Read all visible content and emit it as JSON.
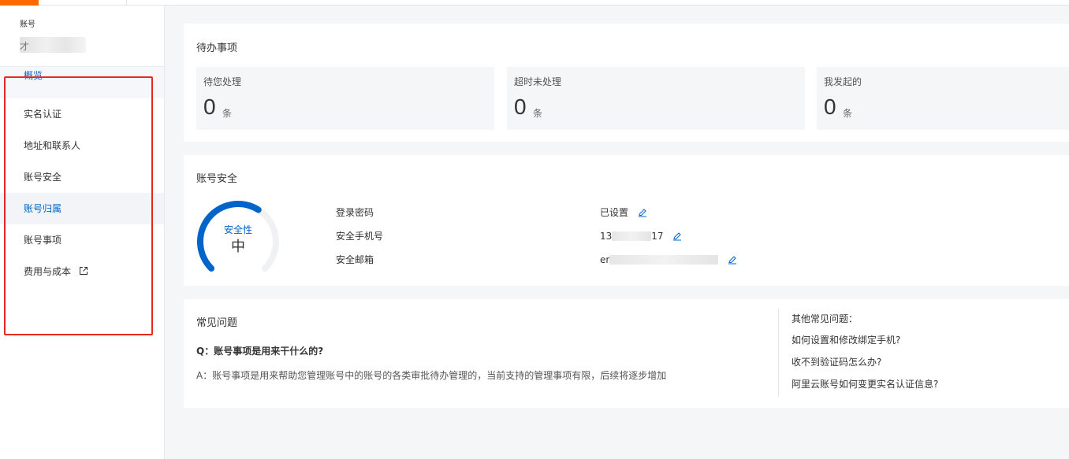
{
  "sidebar": {
    "account_label": "账号",
    "account_name_prefix": "才",
    "items": [
      {
        "label": "概览",
        "active": true
      },
      {
        "label": "实名认证"
      },
      {
        "label": "地址和联系人"
      },
      {
        "label": "账号安全"
      },
      {
        "label": "账号归属",
        "active": true
      },
      {
        "label": "账号事项"
      },
      {
        "label": "费用与成本",
        "external": true
      }
    ]
  },
  "todo": {
    "title": "待办事项",
    "stats": [
      {
        "label": "待您处理",
        "value": "0",
        "unit": "条"
      },
      {
        "label": "超时未处理",
        "value": "0",
        "unit": "条"
      },
      {
        "label": "我发起的",
        "value": "0",
        "unit": "条"
      }
    ]
  },
  "security": {
    "title": "账号安全",
    "gauge_label": "安全性",
    "gauge_level": "中",
    "gauge_fraction": 0.62,
    "rows": [
      {
        "label": "登录密码",
        "value": "已设置"
      },
      {
        "label": "安全手机号",
        "value_start": "13",
        "value_end": "17"
      },
      {
        "label": "安全邮箱",
        "value_start": "er"
      }
    ]
  },
  "faq": {
    "title": "常见问题",
    "question": "Q：账号事项是用来干什么的?",
    "answer": "A：账号事项是用来帮助您管理账号中的账号的各类审批待办管理的，当前支持的管理事项有限，后续将逐步增加",
    "other_title": "其他常见问题：",
    "other_links": [
      "如何设置和修改绑定手机?",
      "收不到验证码怎么办?",
      "阿里云账号如何变更实名认证信息?"
    ]
  },
  "colors": {
    "brand": "#ff6a00",
    "accent": "#0064c8",
    "highlight": "#e8271f"
  }
}
